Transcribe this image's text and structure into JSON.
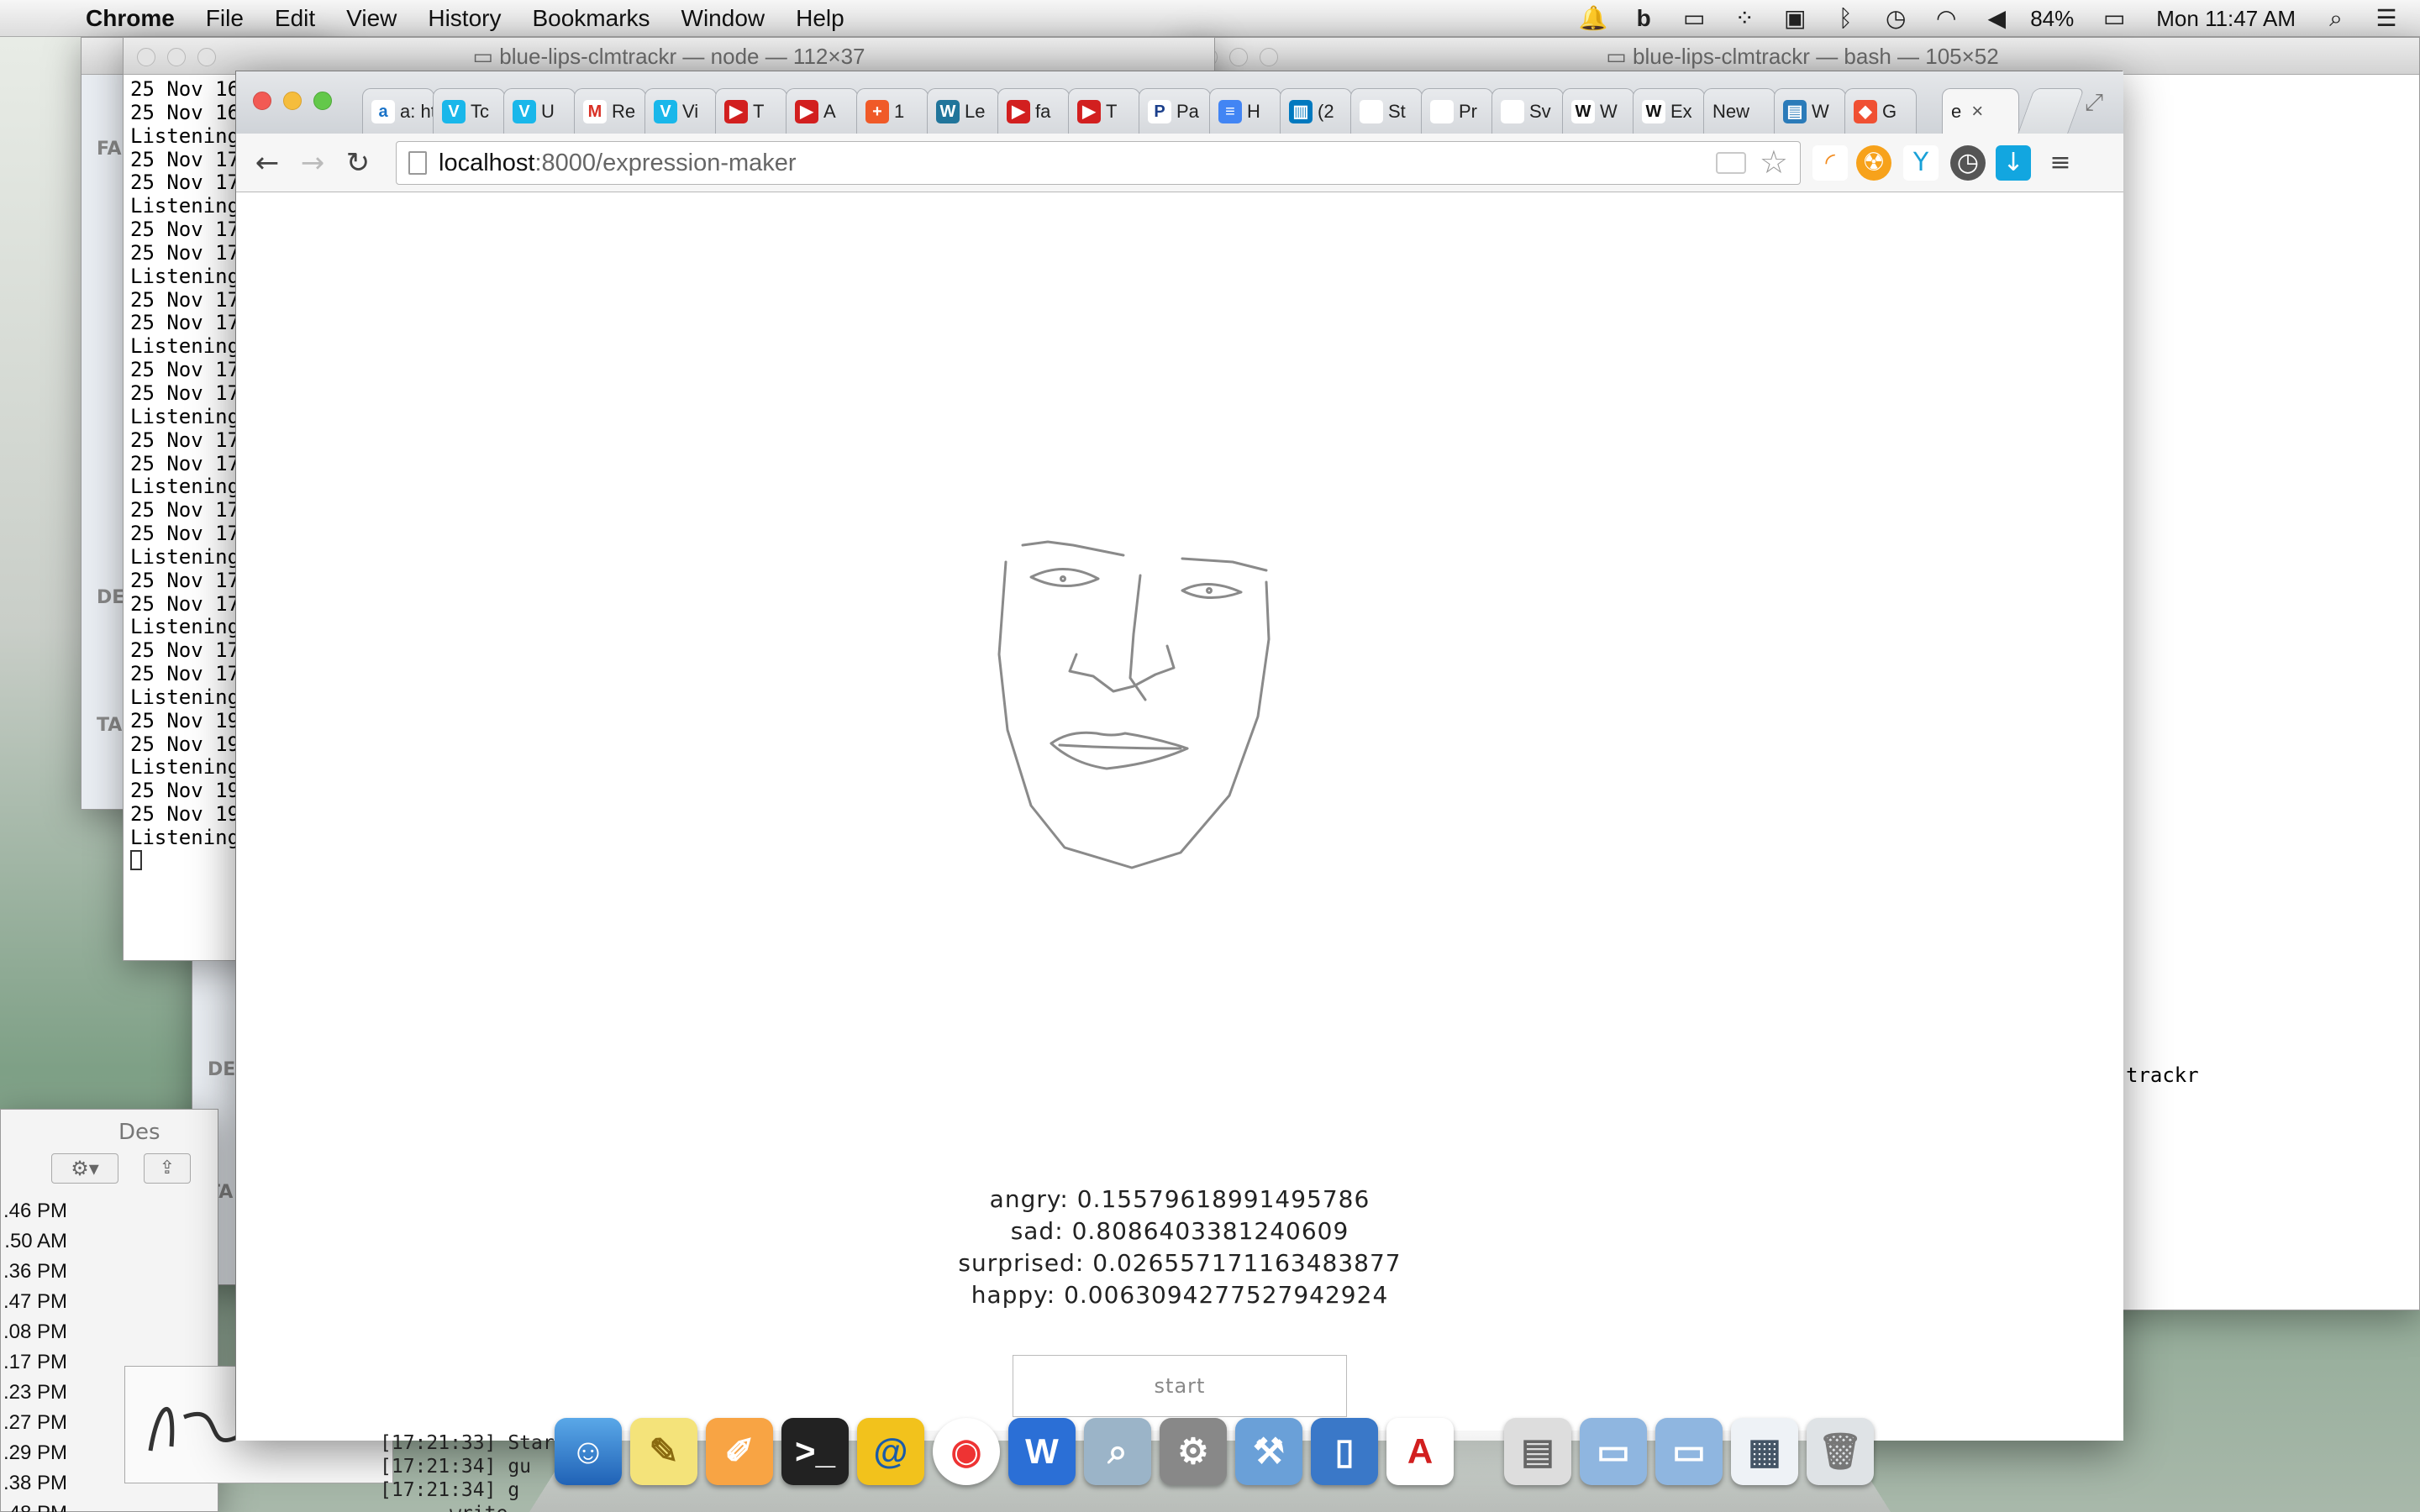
{
  "menubar": {
    "app_name": "Chrome",
    "menus": [
      "File",
      "Edit",
      "View",
      "History",
      "Bookmarks",
      "Window",
      "Help"
    ],
    "battery": "84%",
    "clock": "Mon 11:47 AM"
  },
  "terminal_node": {
    "title": "blue-lips-clmtrackr — node — 112×37",
    "lines": [
      "25 Nov 16",
      "25 Nov 16",
      "Listening",
      "25 Nov 17",
      "25 Nov 17",
      "Listening",
      "25 Nov 17",
      "25 Nov 17",
      "Listening",
      "25 Nov 17",
      "25 Nov 17",
      "Listening",
      "25 Nov 17",
      "25 Nov 17",
      "Listening",
      "25 Nov 17",
      "25 Nov 17",
      "Listening",
      "25 Nov 17",
      "25 Nov 17",
      "Listening",
      "25 Nov 17",
      "25 Nov 17",
      "Listening",
      "25 Nov 17",
      "25 Nov 17",
      "Listening",
      "25 Nov 19",
      "25 Nov 19",
      "Listening",
      "25 Nov 19",
      "25 Nov 19",
      "Listening"
    ]
  },
  "terminal_bash": {
    "title": "blue-lips-clmtrackr — bash — 105×52",
    "visible_text": "trackr"
  },
  "finder": {
    "labels": [
      "FA",
      "DE",
      "TA",
      "DE",
      "TA"
    ],
    "path_label": "Des",
    "times": [
      ".46 PM",
      ".50 AM",
      ".36 PM",
      ".47 PM",
      ".08 PM",
      ".17 PM",
      ".23 PM",
      ".27 PM",
      ".29 PM",
      ".38 PM",
      ".48 PM"
    ]
  },
  "chrome": {
    "tabs": [
      {
        "icon": "amazon-icon",
        "label": "a: ht",
        "color": "#ffffff",
        "fg": "#1a73c8"
      },
      {
        "icon": "vimeo-icon",
        "label": "Tc",
        "color": "#19b7ea",
        "fg": "#fff"
      },
      {
        "icon": "vimeo-icon",
        "label": "U",
        "color": "#19b7ea",
        "fg": "#fff"
      },
      {
        "icon": "gmail-icon",
        "label": "Re",
        "color": "#ffffff",
        "fg": "#d93025"
      },
      {
        "icon": "vimeo-icon",
        "label": "Vi",
        "color": "#19b7ea",
        "fg": "#fff"
      },
      {
        "icon": "youtube-icon",
        "label": "T",
        "color": "#d21f1f",
        "fg": "#fff"
      },
      {
        "icon": "youtube-icon",
        "label": "A",
        "color": "#d21f1f",
        "fg": "#fff"
      },
      {
        "icon": "plus-icon",
        "label": "1",
        "color": "#f05a28",
        "fg": "#fff"
      },
      {
        "icon": "wordpress-icon",
        "label": "Le",
        "color": "#21759b",
        "fg": "#fff"
      },
      {
        "icon": "youtube-icon",
        "label": "fa",
        "color": "#d21f1f",
        "fg": "#fff"
      },
      {
        "icon": "youtube-icon",
        "label": "T",
        "color": "#d21f1f",
        "fg": "#fff"
      },
      {
        "icon": "p-icon",
        "label": "Pa",
        "color": "#ffffff",
        "fg": "#1b3f8b"
      },
      {
        "icon": "docs-icon",
        "label": "H",
        "color": "#4285f4",
        "fg": "#fff"
      },
      {
        "icon": "trello-icon",
        "label": "(2",
        "color": "#0079bf",
        "fg": "#fff"
      },
      {
        "icon": "apple-icon",
        "label": "St",
        "color": "#ffffff",
        "fg": "#555"
      },
      {
        "icon": "apple-icon",
        "label": "Pr",
        "color": "#ffffff",
        "fg": "#555"
      },
      {
        "icon": "apple-icon",
        "label": "Sv",
        "color": "#ffffff",
        "fg": "#555"
      },
      {
        "icon": "wikipedia-icon",
        "label": "W",
        "color": "#ffffff",
        "fg": "#111"
      },
      {
        "icon": "wikipedia-icon",
        "label": "Ex",
        "color": "#ffffff",
        "fg": "#111"
      },
      {
        "icon": "none",
        "label": "New",
        "color": "#ffffff",
        "fg": "#111"
      },
      {
        "icon": "window-icon",
        "label": "W",
        "color": "#2b7bb9",
        "fg": "#fff"
      },
      {
        "icon": "git-icon",
        "label": "G",
        "color": "#f05033",
        "fg": "#fff"
      }
    ],
    "active_tab": {
      "label": "e",
      "close": "×"
    },
    "url_host": "localhost",
    "url_path": ":8000/expression-maker",
    "page": {
      "emotions": [
        {
          "label": "angry",
          "value": "0.15579618991495786"
        },
        {
          "label": "sad",
          "value": "0.8086403381240609"
        },
        {
          "label": "surprised",
          "value": "0.026557171163483877"
        },
        {
          "label": "happy",
          "value": "0.0063094277527942924"
        }
      ],
      "start_label": "start"
    }
  },
  "log": {
    "lines": [
      "[17:21:33] Star",
      "[17:21:34] gu",
      "[17:21:34] g",
      "      write"
    ]
  }
}
